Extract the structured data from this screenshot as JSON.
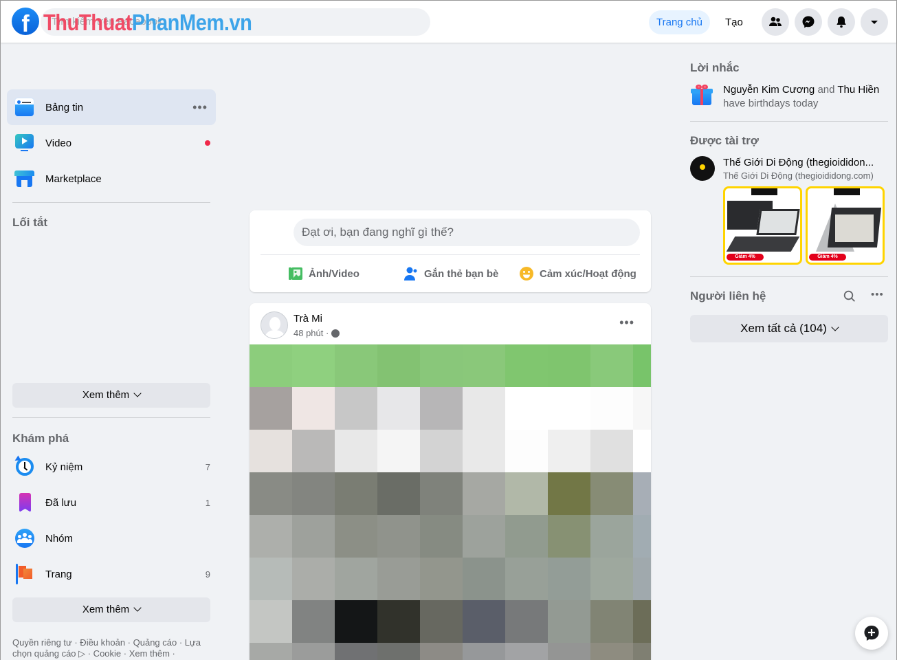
{
  "header": {
    "search_placeholder": "Tìm kiếm trên Facebook",
    "watermark_red": "ThuThuat",
    "watermark_blue": "PhanMem.vn",
    "nav_home": "Trang chủ",
    "nav_create": "Tạo",
    "icons": [
      "friends-icon",
      "messenger-icon",
      "notifications-icon",
      "account-menu-icon"
    ]
  },
  "sidebar": {
    "main_items": [
      {
        "label": "Bảng tin",
        "icon": "news-feed-icon",
        "active": true,
        "extra": "•••"
      },
      {
        "label": "Video",
        "icon": "video-icon",
        "badge": "red-dot"
      },
      {
        "label": "Marketplace",
        "icon": "marketplace-icon"
      }
    ],
    "shortcuts_title": "Lối tắt",
    "see_more_1": "Xem thêm",
    "explore_title": "Khám phá",
    "explore_items": [
      {
        "label": "Kỷ niệm",
        "icon": "memories-icon",
        "count": "7"
      },
      {
        "label": "Đã lưu",
        "icon": "saved-icon",
        "count": "1"
      },
      {
        "label": "Nhóm",
        "icon": "groups-icon",
        "count": ""
      },
      {
        "label": "Trang",
        "icon": "pages-icon",
        "count": "9"
      }
    ],
    "see_more_2": "Xem thêm",
    "footer": "Quyền riêng tư · Điều khoản · Quảng cáo · Lựa chọn quảng cáo ▷ · Cookie · Xem thêm ·"
  },
  "composer": {
    "placeholder": "Đạt ơi, bạn đang nghĩ gì thế?",
    "actions": [
      {
        "label": "Ảnh/Video",
        "icon": "photo-video-icon",
        "color": "#45bd62"
      },
      {
        "label": "Gắn thẻ bạn bè",
        "icon": "tag-friends-icon",
        "color": "#1877f2"
      },
      {
        "label": "Cảm xúc/Hoạt động",
        "icon": "feeling-icon",
        "color": "#f7b928"
      }
    ]
  },
  "post": {
    "author": "Trà Mi",
    "time": "48 phút ·",
    "privacy_icon": "globe-icon",
    "menu": "•••",
    "image": "pixelated photo",
    "mosaic_colors": [
      [
        "#8ccd7c",
        "#8fd07f",
        "#89c879",
        "#83c272",
        "#89c77a",
        "#8ac87a",
        "#80c66f",
        "#7fc56e",
        "#89c97a",
        "#78c46a"
      ],
      [
        "#a6a19f",
        "#efe6e4",
        "#c7c7c7",
        "#e7e7e9",
        "#b7b6b7",
        "#e8e8e8",
        "#ffffff",
        "#ffffff",
        "#fdfdfd",
        "#f7f7f7"
      ],
      [
        "#e6e1de",
        "#bab9b8",
        "#e8e8e8",
        "#f5f5f5",
        "#d3d3d3",
        "#e9e9e9",
        "#fdfdfd",
        "#efefef",
        "#e0e0e0",
        "#ffffff"
      ],
      [
        "#898b85",
        "#838580",
        "#7a7d73",
        "#6a6d66",
        "#7f827b",
        "#a6a8a3",
        "#b1b8a8",
        "#727746",
        "#878c75",
        "#a7aeb6"
      ],
      [
        "#adafab",
        "#9ea19c",
        "#8c8f86",
        "#90938c",
        "#868b82",
        "#9da29c",
        "#919b8f",
        "#879173",
        "#9ba59c",
        "#a1acb2"
      ],
      [
        "#b6bbb8",
        "#abada9",
        "#a0a59f",
        "#999c96",
        "#93968d",
        "#8b938c",
        "#98a098",
        "#939d97",
        "#9ea89e",
        "#a0a9ad"
      ],
      [
        "#c4c6c3",
        "#818382",
        "#141617",
        "#31322b",
        "#676860",
        "#5a5e69",
        "#77797a",
        "#939a93",
        "#818474",
        "#6c6d58"
      ],
      [
        "#a7a9a6",
        "#9b9c9b",
        "#707173",
        "#6e706d",
        "#8d8b86",
        "#96989a",
        "#a2a3a5",
        "#949594",
        "#8e8c80",
        "#7f7f72"
      ]
    ]
  },
  "right": {
    "reminders_title": "Lời nhắc",
    "birthday": {
      "name1": "Nguyễn Kim Cương",
      "and": "and",
      "name2": "Thu Hiền",
      "text": "have birthdays today"
    },
    "sponsored_title": "Được tài trợ",
    "ad": {
      "title": "Thế Giới Di Động (thegioididon...",
      "subtitle": "Thế Giới Di Động (thegioididong.com)",
      "cards": [
        {
          "badge": "Giảm 4%",
          "product": "laptop"
        },
        {
          "badge": "Giảm 4%",
          "product": "convertible-laptop"
        }
      ]
    },
    "contacts_title": "Người liên hệ",
    "see_all": "Xem tất cả (104)"
  }
}
